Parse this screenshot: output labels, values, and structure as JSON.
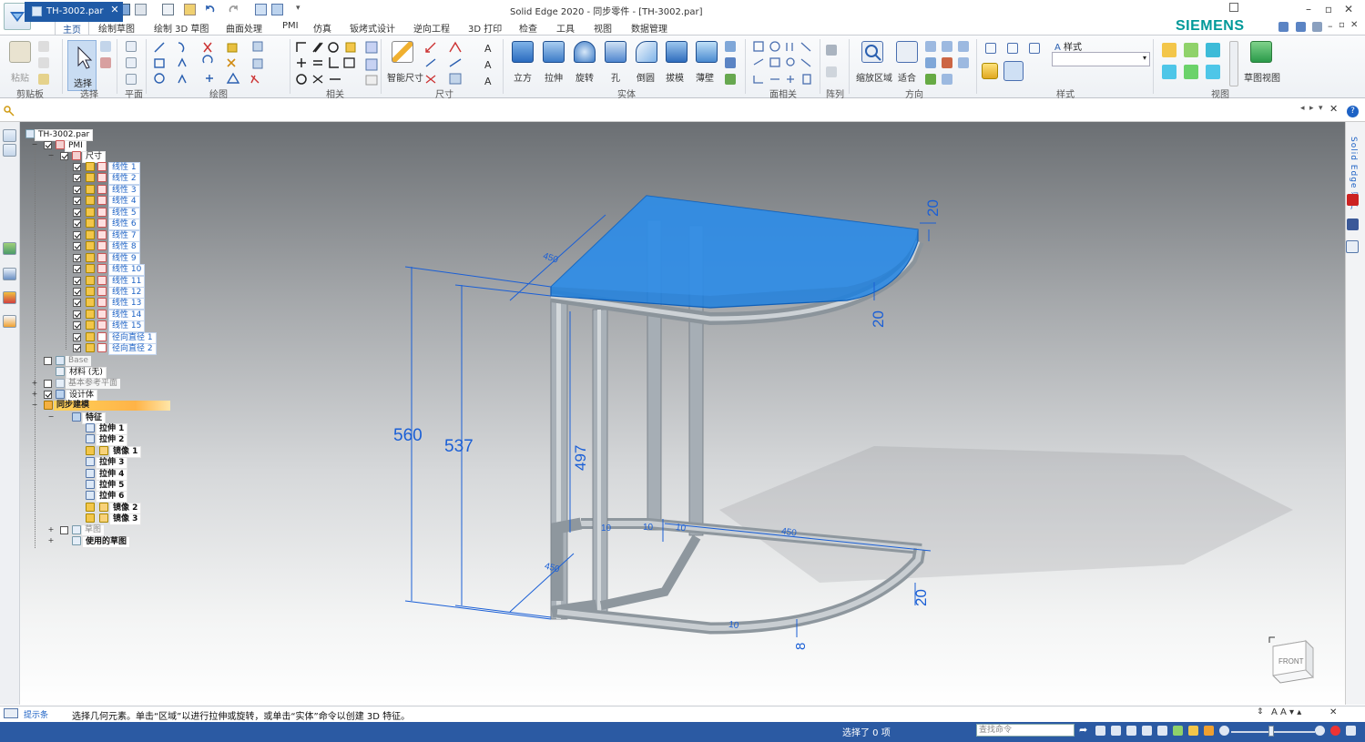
{
  "window": {
    "title": "Solid Edge 2020 - 同步零件 - [TH-3002.par]",
    "brand": "SIEMENS",
    "controls": [
      "–",
      "▫",
      "✕"
    ]
  },
  "ribbon": {
    "tabs": [
      "主页",
      "绘制草图",
      "绘制 3D 草图",
      "曲面处理",
      "PMI",
      "仿真",
      "钣烤式设计",
      "逆向工程",
      "3D 打印",
      "检查",
      "工具",
      "视图",
      "数据管理"
    ],
    "active_tab": "主页",
    "groups": {
      "clipboard": "剪贴板",
      "select": "选择",
      "plane": "平面",
      "draw": "绘图",
      "relate": "相关",
      "dimension": "尺寸",
      "solids": "实体",
      "face_relate": "面相关",
      "pattern": "阵列",
      "orient": "方向",
      "style": "样式",
      "views": "视图"
    },
    "buttons": {
      "paste": "粘贴",
      "select": "选择",
      "smart_dim": "智能尺寸",
      "box": "立方",
      "extrude": "拉伸",
      "revolve": "旋转",
      "hole": "孔",
      "round": "倒圆",
      "draft": "拔模",
      "thin_wall": "薄壁",
      "zoom_area": "缩放区域",
      "fit": "适合",
      "sketch_view": "草图视图"
    },
    "style_label": "样式",
    "style_value": ""
  },
  "document_tab": {
    "name": "TH-3002.par",
    "close": "✕"
  },
  "tree": {
    "root": "TH-3002.par",
    "pmi": "PMI",
    "dims_folder": "尺寸",
    "dims": [
      "线性 1",
      "线性 2",
      "线性 3",
      "线性 4",
      "线性 5",
      "线性 6",
      "线性 7",
      "线性 8",
      "线性 9",
      "线性 10",
      "线性 11",
      "线性 12",
      "线性 13",
      "线性 14",
      "线性 15",
      "径向直径 1",
      "径向直径 2"
    ],
    "base": "Base",
    "material": "材料 (无)",
    "base_planes": "基本参考平面",
    "design_body": "设计体",
    "sync_modeling": "同步建模",
    "features_folder": "特征",
    "features": [
      "拉伸 1",
      "拉伸 2",
      "镜像 1",
      "拉伸 3",
      "拉伸 4",
      "拉伸 5",
      "拉伸 6",
      "镜像 2",
      "镜像 3"
    ],
    "sketches": "草图",
    "used_sketches": "使用的草图"
  },
  "model": {
    "dimensions": {
      "height_total": "560",
      "height_leg": "537",
      "height_inner": "497",
      "top_depth": "450",
      "top_thickness": "20",
      "top_edge": "20",
      "base_depth": "450",
      "base_width": "450",
      "base_height": "20",
      "tube_1": "10",
      "tube_2": "10",
      "tube_3": "10",
      "small_8": "8",
      "small_10": "10"
    },
    "colors": {
      "highlight": "#1a7fe0",
      "dimension": "#1a5fd6",
      "frame": "#9aa3ab"
    }
  },
  "view_cube": {
    "face": "FRONT"
  },
  "right_strip": {
    "label": "Solid Edge 门户"
  },
  "prompt": {
    "label": "提示条",
    "text": "选择几何元素。单击“区域”以进行拉伸或旋转，或单击“实体”命令以创建 3D 特征。"
  },
  "status": {
    "selected": "选择了 0 项",
    "search_placeholder": "查找命令"
  }
}
